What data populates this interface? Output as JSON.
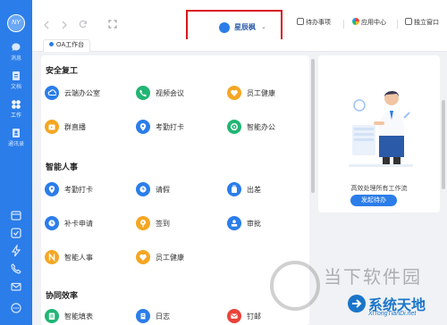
{
  "rail": {
    "avatar_text": "NY",
    "items": [
      {
        "label": "消息"
      },
      {
        "label": "文档"
      },
      {
        "label": "工作"
      },
      {
        "label": "通讯录"
      }
    ]
  },
  "topbar": {
    "user_name": "星辰枫",
    "caret": "⌄",
    "todo_label": "待办事项",
    "app_center_label": "应用中心",
    "window_label": "独立窗口"
  },
  "tab": {
    "label": "OA工作台"
  },
  "sections": [
    {
      "title": "安全复工",
      "items": [
        {
          "label": "云端办公室",
          "icon": "cloud-icon",
          "color": "#2b7de9"
        },
        {
          "label": "视频会议",
          "icon": "phone-icon",
          "color": "#21b573"
        },
        {
          "label": "员工健康",
          "icon": "heart-icon",
          "color": "#f5a623"
        },
        {
          "label": "群直播",
          "icon": "live-icon",
          "color": "#f5a623"
        },
        {
          "label": "考勤打卡",
          "icon": "location-icon",
          "color": "#2b7de9"
        },
        {
          "label": "智能办公",
          "icon": "ring-icon",
          "color": "#21b573"
        }
      ]
    },
    {
      "title": "智能人事",
      "items": [
        {
          "label": "考勤打卡",
          "icon": "location-icon",
          "color": "#2b7de9"
        },
        {
          "label": "请假",
          "icon": "clock-icon",
          "color": "#2b7de9"
        },
        {
          "label": "出差",
          "icon": "suitcase-icon",
          "color": "#2b7de9"
        },
        {
          "label": "补卡申请",
          "icon": "clock-icon",
          "color": "#2b7de9"
        },
        {
          "label": "签到",
          "icon": "pin-icon",
          "color": "#f5a623"
        },
        {
          "label": "审批",
          "icon": "stamp-icon",
          "color": "#2b7de9"
        },
        {
          "label": "智能人事",
          "icon": "n-icon",
          "color": "#f5a623"
        },
        {
          "label": "员工健康",
          "icon": "heart-icon",
          "color": "#f5a623"
        }
      ]
    },
    {
      "title": "协同效率",
      "items": [
        {
          "label": "智能填表",
          "icon": "form-icon",
          "color": "#21b573"
        },
        {
          "label": "日志",
          "icon": "log-icon",
          "color": "#2b7de9"
        },
        {
          "label": "钉邮",
          "icon": "mail-icon",
          "color": "#e9423a"
        }
      ]
    }
  ],
  "panel": {
    "text": "高效处理所有工作流",
    "button": "发起待办"
  },
  "watermark": {
    "cn": "当下软件园",
    "brand": "系统天地",
    "url": "XiTongTianDi.net"
  }
}
